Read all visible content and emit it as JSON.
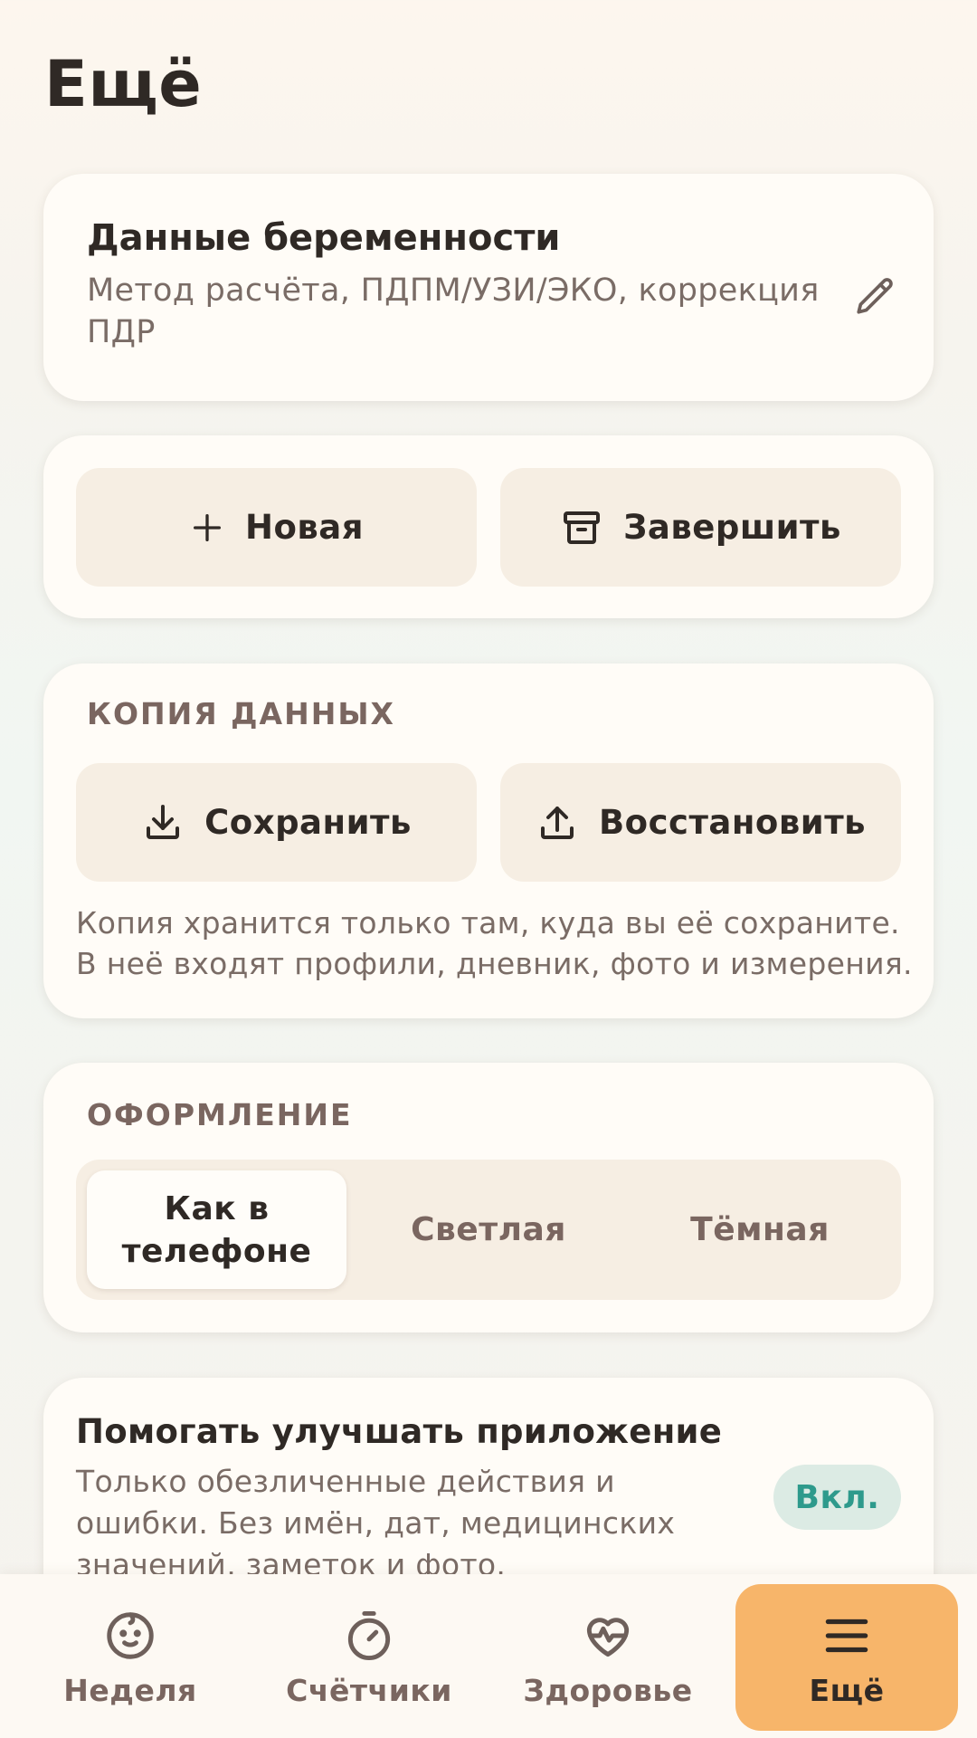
{
  "page": {
    "title": "Ещё"
  },
  "pregnancy": {
    "title": "Данные беременности",
    "subtitle": "Метод расчёта, ПДПМ/УЗИ/ЭКО, коррекция ПДР",
    "edit_icon": "pencil-icon"
  },
  "actions": {
    "new_label": "Новая",
    "new_icon": "plus-icon",
    "finish_label": "Завершить",
    "finish_icon": "archive-icon"
  },
  "backup": {
    "section_label": "КОПИЯ ДАННЫХ",
    "save_label": "Сохранить",
    "save_icon": "download-icon",
    "restore_label": "Восстановить",
    "restore_icon": "upload-icon",
    "note": "Копия хранится только там, куда вы её сохраните. В неё входят профили, дневник, фото и измерения."
  },
  "theme": {
    "section_label": "ОФОРМЛЕНИЕ",
    "options": [
      "Как в телефоне",
      "Светлая",
      "Тёмная"
    ],
    "selected": "Как в телефоне"
  },
  "improve": {
    "title": "Помогать улучшать приложение",
    "description": "Только обезличенные действия и ошибки. Без имён, дат, медицинских значений, заметок и фото.",
    "toggle_label": "Вкл."
  },
  "nav": {
    "items": [
      {
        "label": "Неделя",
        "icon": "baby-face-icon"
      },
      {
        "label": "Счётчики",
        "icon": "stopwatch-icon"
      },
      {
        "label": "Здоровье",
        "icon": "heart-pulse-icon"
      },
      {
        "label": "Ещё",
        "icon": "menu-icon"
      }
    ],
    "active": "Ещё"
  },
  "colors": {
    "accent": "#f7b56a",
    "toggle_on": "#2e9a8c",
    "toggle_bg": "#dcebe4",
    "button_bg": "#f6eee3",
    "card_bg": "#fffcf7"
  }
}
